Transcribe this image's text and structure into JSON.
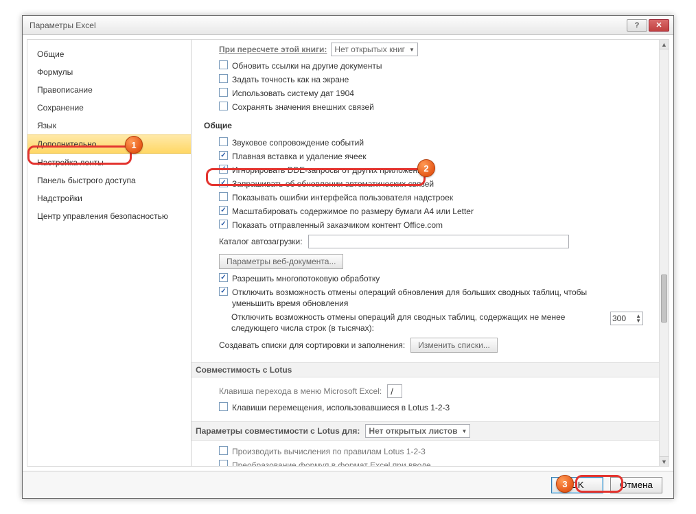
{
  "title": "Параметры Excel",
  "sidebar": {
    "items": [
      {
        "label": "Общие"
      },
      {
        "label": "Формулы"
      },
      {
        "label": "Правописание"
      },
      {
        "label": "Сохранение"
      },
      {
        "label": "Язык"
      },
      {
        "label": "Дополнительно",
        "selected": true
      },
      {
        "label": "Настройка ленты"
      },
      {
        "label": "Панель быстрого доступа"
      },
      {
        "label": "Надстройки"
      },
      {
        "label": "Центр управления безопасностью"
      }
    ]
  },
  "partial": {
    "recalc_label": "При пересчете этой книги:",
    "recalc_value": "Нет открытых книг",
    "items": [
      {
        "label": "Обновить ссылки на другие документы",
        "checked": false
      },
      {
        "label": "Задать точность как на экране",
        "checked": false
      },
      {
        "label": "Использовать систему дат 1904",
        "checked": false
      },
      {
        "label": "Сохранять значения внешних связей",
        "checked": false
      }
    ]
  },
  "general": {
    "title": "Общие",
    "items": [
      {
        "label": "Звуковое сопровождение событий",
        "checked": false
      },
      {
        "label": "Плавная вставка и удаление ячеек",
        "checked": true
      },
      {
        "label": "Игнорировать DDE-запросы от других приложений",
        "checked": true
      },
      {
        "label": "Запрашивать об обновлении автоматических связей",
        "checked": true
      },
      {
        "label": "Показывать ошибки интерфейса пользователя надстроек",
        "checked": false
      },
      {
        "label": "Масштабировать содержимое по размеру бумаги A4 или Letter",
        "checked": true
      },
      {
        "label": "Показать отправленный заказчиком контент Office.com",
        "checked": true
      }
    ],
    "catalog_label": "Каталог автозагрузки:",
    "catalog_value": "",
    "webdoc_btn": "Параметры веб-документа...",
    "multithread": {
      "label": "Разрешить многопотоковую обработку",
      "checked": true
    },
    "disable_undo_pivot": {
      "label": "Отключить возможность отмены операций обновления для больших сводных таблиц, чтобы уменьшить время обновления",
      "checked": true
    },
    "disable_undo_rows": {
      "label": "Отключить возможность отмены операций для сводных таблиц, содержащих не менее следующего числа строк (в тысячах):",
      "value": "300"
    },
    "sortfill_label": "Создавать списки для сортировки и заполнения:",
    "sortfill_btn": "Изменить списки..."
  },
  "lotus": {
    "title": "Совместимость с Lotus",
    "hotkey_label": "Клавиша перехода в меню Microsoft Excel:",
    "hotkey_value": "/",
    "nav": {
      "label": "Клавиши перемещения, использовавшиеся в Lotus 1-2-3",
      "checked": false
    }
  },
  "lotus_compat": {
    "title": "Параметры совместимости с Lotus для:",
    "sheet_value": "Нет открытых листов",
    "items": [
      {
        "label": "Производить вычисления по правилам Lotus 1-2-3",
        "checked": false
      },
      {
        "label": "Преобразование формул в формат Excel при вводе",
        "checked": false
      }
    ]
  },
  "footer": {
    "ok": "OK",
    "cancel": "Отмена"
  },
  "callouts": {
    "c1": "1",
    "c2": "2",
    "c3": "3"
  }
}
